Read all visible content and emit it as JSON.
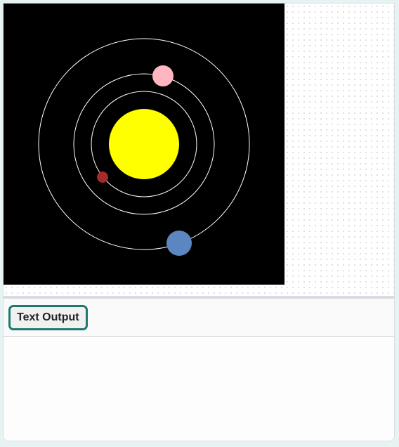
{
  "toolbar": {
    "text_output_label": "Text Output"
  },
  "output": {
    "text": ""
  },
  "scene": {
    "background": "#000000",
    "sun": {
      "color": "#ffff00"
    },
    "orbits": [
      {
        "name": "inner",
        "color": "#ffffff"
      },
      {
        "name": "middle",
        "color": "#ffffff"
      },
      {
        "name": "outer",
        "color": "#ffffff"
      }
    ],
    "planets": [
      {
        "name": "red-planet",
        "color": "#a52a2a"
      },
      {
        "name": "pink-planet",
        "color": "#ffb6c1"
      },
      {
        "name": "blue-planet",
        "color": "#5b86c0"
      }
    ]
  }
}
